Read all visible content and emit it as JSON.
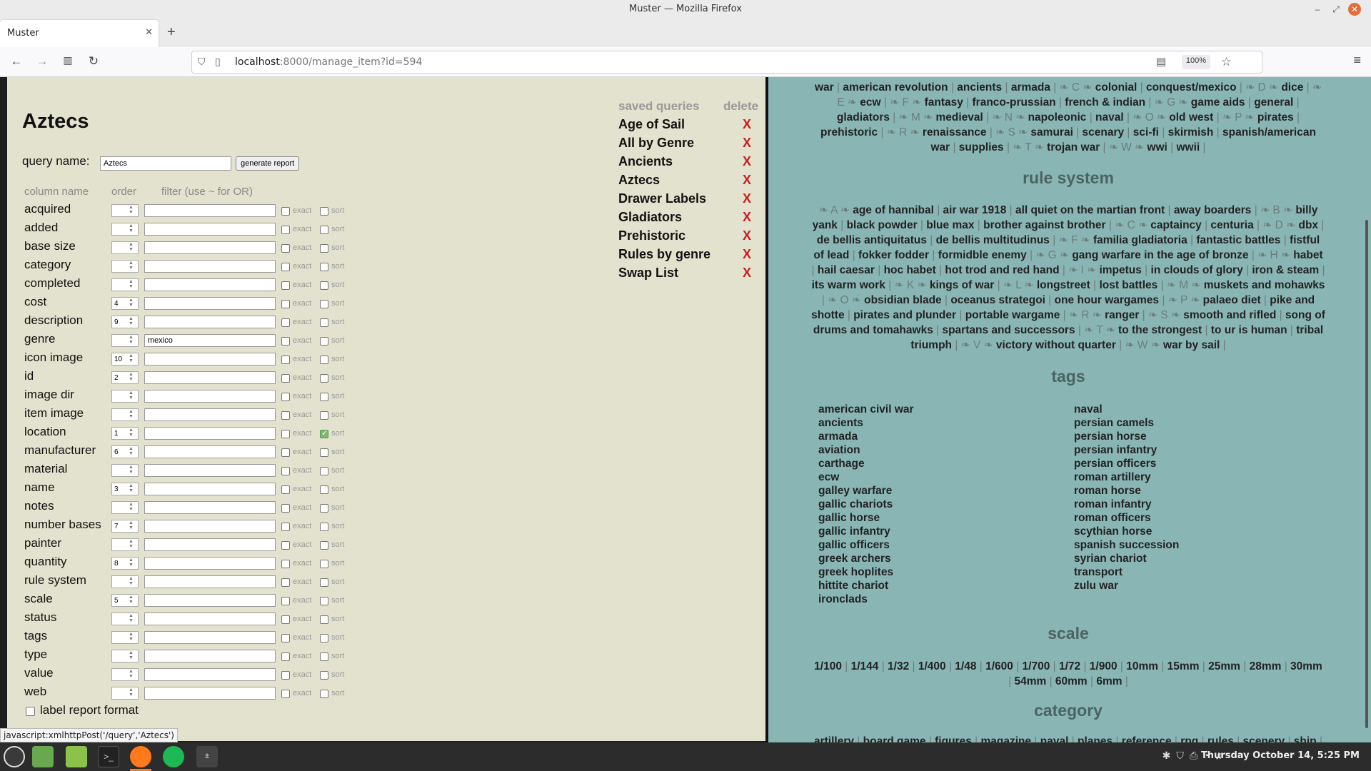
{
  "window": {
    "title": "Muster — Mozilla Firefox"
  },
  "tab": {
    "title": "Muster",
    "close": "✕"
  },
  "url": {
    "host": "localhost",
    "path": ":8000/manage_item?id=594",
    "zoom": "100%"
  },
  "page": {
    "heading": "Aztecs",
    "query_name_label": "query name:",
    "query_name_value": "Aztecs",
    "generate_label": "generate report",
    "headers": {
      "column": "column name",
      "order": "order",
      "filter": "filter (use ~ for OR)"
    },
    "exact_label": "exact",
    "sort_label": "sort",
    "rows": [
      {
        "name": "acquired",
        "order": "",
        "filter": "",
        "sort": false
      },
      {
        "name": "added",
        "order": "",
        "filter": "",
        "sort": false
      },
      {
        "name": "base size",
        "order": "",
        "filter": "",
        "sort": false
      },
      {
        "name": "category",
        "order": "",
        "filter": "",
        "sort": false
      },
      {
        "name": "completed",
        "order": "",
        "filter": "",
        "sort": false
      },
      {
        "name": "cost",
        "order": "4",
        "filter": "",
        "sort": false
      },
      {
        "name": "description",
        "order": "9",
        "filter": "",
        "sort": false
      },
      {
        "name": "genre",
        "order": "",
        "filter": "mexico",
        "sort": false
      },
      {
        "name": "icon image",
        "order": "10",
        "filter": "",
        "sort": false
      },
      {
        "name": "id",
        "order": "2",
        "filter": "",
        "sort": false
      },
      {
        "name": "image dir",
        "order": "",
        "filter": "",
        "sort": false
      },
      {
        "name": "item image",
        "order": "",
        "filter": "",
        "sort": false
      },
      {
        "name": "location",
        "order": "1",
        "filter": "",
        "sort": true
      },
      {
        "name": "manufacturer",
        "order": "6",
        "filter": "",
        "sort": false
      },
      {
        "name": "material",
        "order": "",
        "filter": "",
        "sort": false
      },
      {
        "name": "name",
        "order": "3",
        "filter": "",
        "sort": false
      },
      {
        "name": "notes",
        "order": "",
        "filter": "",
        "sort": false
      },
      {
        "name": "number bases",
        "order": "7",
        "filter": "",
        "sort": false
      },
      {
        "name": "painter",
        "order": "",
        "filter": "",
        "sort": false
      },
      {
        "name": "quantity",
        "order": "8",
        "filter": "",
        "sort": false
      },
      {
        "name": "rule system",
        "order": "",
        "filter": "",
        "sort": false
      },
      {
        "name": "scale",
        "order": "5",
        "filter": "",
        "sort": false
      },
      {
        "name": "status",
        "order": "",
        "filter": "",
        "sort": false
      },
      {
        "name": "tags",
        "order": "",
        "filter": "",
        "sort": false
      },
      {
        "name": "type",
        "order": "",
        "filter": "",
        "sort": false
      },
      {
        "name": "value",
        "order": "",
        "filter": "",
        "sort": false
      },
      {
        "name": "web",
        "order": "",
        "filter": "",
        "sort": false
      }
    ],
    "label_report_format": "label report format",
    "saved_queries_title": "saved queries",
    "delete_title": "delete",
    "delete_mark": "X",
    "saved_queries": [
      "Age of Sail",
      "All by Genre",
      "Ancients",
      "Aztecs",
      "Drawer Labels",
      "Gladiators",
      "Prehistoric",
      "Rules by genre",
      "Swap List"
    ]
  },
  "era_cloud": [
    {
      "items": [
        "war",
        "american revolution",
        "ancients",
        "armada"
      ]
    },
    {
      "letter": "C",
      "items": [
        "colonial",
        "conquest/mexico"
      ]
    },
    {
      "letter": "D",
      "items": [
        "dice"
      ]
    },
    {
      "letter": "E",
      "items": [
        "ecw"
      ]
    },
    {
      "letter": "F",
      "items": [
        "fantasy",
        "franco-prussian",
        "french & indian"
      ]
    },
    {
      "letter": "G",
      "items": [
        "game aids",
        "general",
        "gladiators"
      ]
    },
    {
      "letter": "M",
      "items": [
        "medieval"
      ]
    },
    {
      "letter": "N",
      "items": [
        "napoleonic",
        "naval"
      ]
    },
    {
      "letter": "O",
      "items": [
        "old west"
      ]
    },
    {
      "letter": "P",
      "items": [
        "pirates",
        "prehistoric"
      ]
    },
    {
      "letter": "R",
      "items": [
        "renaissance"
      ]
    },
    {
      "letter": "S",
      "items": [
        "samurai",
        "scenary",
        "sci-fi",
        "skirmish",
        "spanish/american war",
        "supplies"
      ]
    },
    {
      "letter": "T",
      "items": [
        "trojan war"
      ]
    },
    {
      "letter": "W",
      "items": [
        "wwi",
        "wwii"
      ]
    }
  ],
  "rule_system": {
    "title": "rule system",
    "groups": [
      {
        "letter": "A",
        "items": [
          "age of hannibal",
          "air war 1918",
          "all quiet on the martian front",
          "away boarders"
        ]
      },
      {
        "letter": "B",
        "items": [
          "billy yank",
          "black powder",
          "blue max",
          "brother against brother"
        ]
      },
      {
        "letter": "C",
        "items": [
          "captaincy",
          "centuria"
        ]
      },
      {
        "letter": "D",
        "items": [
          "dbx",
          "de bellis antiquitatus",
          "de bellis multitudinus"
        ]
      },
      {
        "letter": "F",
        "items": [
          "familia gladiatoria",
          "fantastic battles",
          "fistful of lead",
          "fokker fodder",
          "formidble enemy"
        ]
      },
      {
        "letter": "G",
        "items": [
          "gang warfare in the age of bronze"
        ]
      },
      {
        "letter": "H",
        "items": [
          "habet",
          "hail caesar",
          "hoc habet",
          "hot trod and red hand"
        ]
      },
      {
        "letter": "I",
        "items": [
          "impetus",
          "in clouds of glory",
          "iron & steam",
          "its warm work"
        ]
      },
      {
        "letter": "K",
        "items": [
          "kings of war"
        ]
      },
      {
        "letter": "L",
        "items": [
          "longstreet",
          "lost battles"
        ]
      },
      {
        "letter": "M",
        "items": [
          "muskets and mohawks"
        ]
      },
      {
        "letter": "O",
        "items": [
          "obsidian blade",
          "oceanus strategoi",
          "one hour wargames"
        ]
      },
      {
        "letter": "P",
        "items": [
          "palaeo diet",
          "pike and shotte",
          "pirates and plunder",
          "portable wargame"
        ]
      },
      {
        "letter": "R",
        "items": [
          "ranger"
        ]
      },
      {
        "letter": "S",
        "items": [
          "smooth and rifled",
          "song of drums and tomahawks",
          "spartans and successors"
        ]
      },
      {
        "letter": "T",
        "items": [
          "to the strongest",
          "to ur is human",
          "tribal triumph"
        ]
      },
      {
        "letter": "V",
        "items": [
          "victory without quarter"
        ]
      },
      {
        "letter": "W",
        "items": [
          "war by sail"
        ]
      }
    ]
  },
  "tags": {
    "title": "tags",
    "left": [
      "american civil war",
      "ancients",
      "armada",
      "aviation",
      "carthage",
      "ecw",
      "galley warfare",
      "gallic chariots",
      "gallic horse",
      "gallic infantry",
      "gallic officers",
      "greek archers",
      "greek hoplites",
      "hittite chariot",
      "ironclads"
    ],
    "right": [
      "naval",
      "persian camels",
      "persian horse",
      "persian infantry",
      "persian officers",
      "roman artillery",
      "roman horse",
      "roman infantry",
      "roman officers",
      "scythian horse",
      "spanish succession",
      "syrian chariot",
      "transport",
      "zulu war"
    ]
  },
  "scale": {
    "title": "scale",
    "items": [
      "1/100",
      "1/144",
      "1/32",
      "1/400",
      "1/48",
      "1/600",
      "1/700",
      "1/72",
      "1/900",
      "10mm",
      "15mm",
      "25mm",
      "28mm",
      "30mm",
      "54mm",
      "60mm",
      "6mm"
    ]
  },
  "category": {
    "title": "category",
    "items": [
      "artillery",
      "board game",
      "figures",
      "magazine",
      "naval",
      "planes",
      "reference",
      "rpg",
      "rules",
      "scenery",
      "ship"
    ]
  },
  "status_link": "javascript:xmlhttpPost('/query','Aztecs')",
  "clock": "Thursday October 14, 5:25 PM",
  "icons": {
    "back": "arrow-left",
    "forward": "arrow-right",
    "reload": "reload",
    "menu": "hamburger"
  }
}
